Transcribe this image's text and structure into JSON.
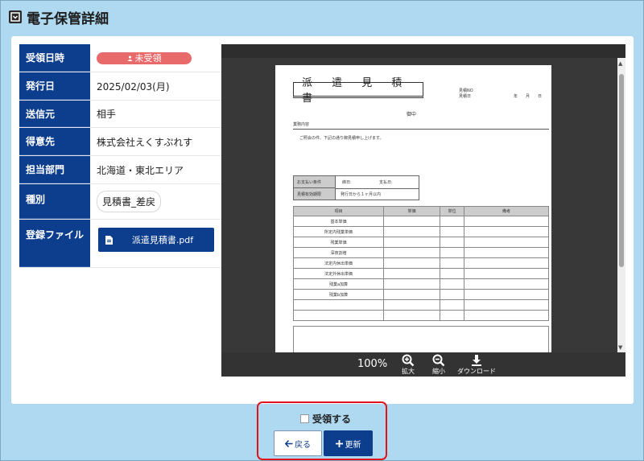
{
  "header": {
    "title": "電子保管詳細",
    "icon": "archive-icon"
  },
  "info": {
    "received_label": "受領日時",
    "received_status": "未受領",
    "issue_date_label": "発行日",
    "issue_date": "2025/02/03(月)",
    "sender_label": "送信元",
    "sender": "相手",
    "client_label": "得意先",
    "client": "株式会社えくすぷれす",
    "dept_label": "担当部門",
    "dept": "北海道・東北エリア",
    "type_label": "種別",
    "type_tag": "見積書_差戻",
    "file_label": "登録ファイル",
    "file_name": "派遣見積書.pdf"
  },
  "document": {
    "title": "派 遣 見 積 書",
    "meta1": "見積NO",
    "meta2": "見積日",
    "date_line": "年　　月　　日",
    "to": "御中",
    "subject": "業務内容",
    "body": "ご照会の件、下記の通り御見積申し上げます。",
    "pay_label": "お支払い条件",
    "pay_val1": "締日:",
    "pay_val2": "支払日:",
    "valid_label": "見積有効期限",
    "valid_val": "発行日から１ヶ月以内",
    "table_headers": [
      "項目",
      "単価",
      "単位",
      "備考"
    ],
    "table_rows": [
      "基本単価",
      "所定内残業単価",
      "残業単価",
      "深夜割増",
      "法定内休出単価",
      "法定外休出単価",
      "残業a加算",
      "残業b加算",
      "",
      ""
    ]
  },
  "viewer": {
    "zoom": "100%",
    "zoom_in_label": "拡大",
    "zoom_out_label": "縮小",
    "download_label": "ダウンロード"
  },
  "actions": {
    "receive_label": "受領する",
    "receive_checked": false,
    "back_label": "戻る",
    "update_label": "更新"
  },
  "colors": {
    "primary": "#0d3e8e",
    "background": "#aed9f0",
    "badge": "#e86a6a",
    "highlight": "#e0141c"
  }
}
